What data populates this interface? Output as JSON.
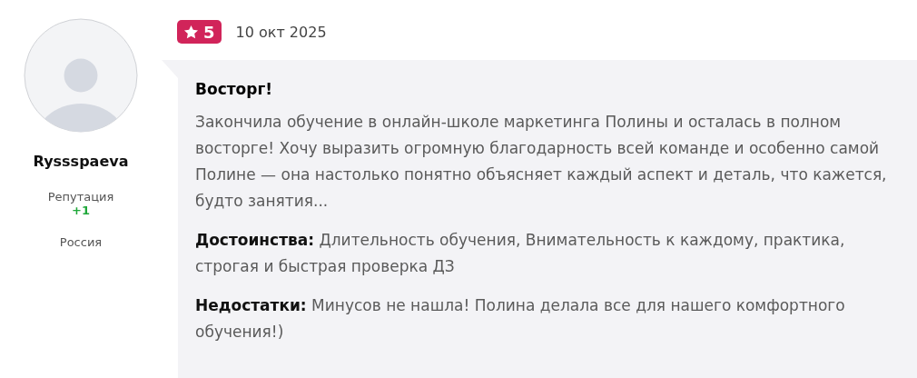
{
  "author": {
    "name": "Ryssspaeva",
    "reputation_label": "Репутация",
    "reputation": "+1",
    "country": "Россия"
  },
  "review": {
    "rating": "5",
    "date": "10 окт 2025",
    "title": "Восторг!",
    "body": "Закончила обучение в онлайн-школе маркетинга Полины и осталась в полном восторге! Хочу выразить огромную благодарность всей команде и особенно самой Полине — она настолько понятно объясняет каждый аспект и деталь, что кажется, будто занятия...",
    "sections": [
      {
        "text": "**Достоинства:** Длительность обучения, Внимательность к каждому, практика, строгая и быстрая проверка ДЗ"
      },
      {
        "text": "**Недостатки:** Минусов не нашла! Полина делала все для нашего комфортного обучения!)"
      }
    ]
  }
}
